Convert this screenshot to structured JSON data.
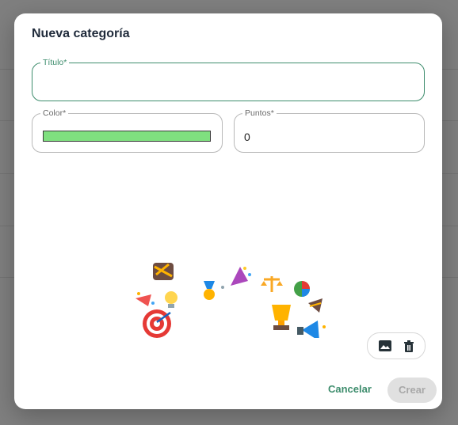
{
  "dialog": {
    "title": "Nueva categoría",
    "fields": {
      "title": {
        "label": "Título",
        "required_mark": "*",
        "value": ""
      },
      "color": {
        "label": "Color",
        "required_mark": "*",
        "value": "#7fe07f"
      },
      "points": {
        "label": "Puntos",
        "required_mark": "*",
        "value": "0"
      }
    },
    "image_tools": {
      "image_icon": "image-icon",
      "delete_icon": "trash-icon"
    },
    "actions": {
      "cancel_label": "Cancelar",
      "create_label": "Crear"
    }
  },
  "colors": {
    "accent": "#3e8d6d",
    "swatch": "#7fe07f",
    "disabled_bg": "#e0e0e0"
  }
}
